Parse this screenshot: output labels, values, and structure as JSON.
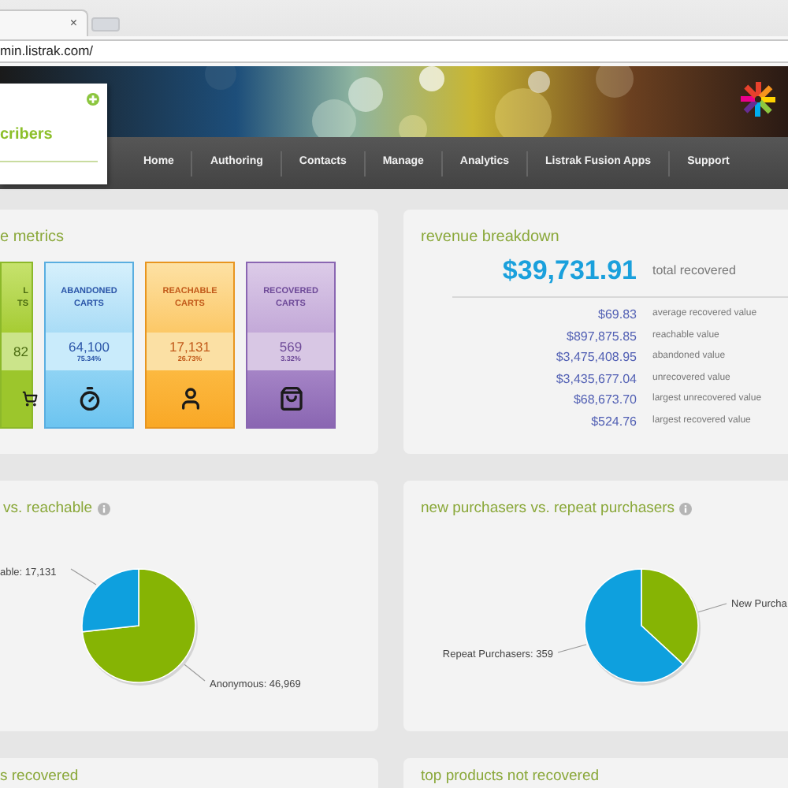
{
  "browser": {
    "tab_close": "×",
    "address": "min.listrak.com/"
  },
  "header": {
    "panel_title": "cribers",
    "nav": [
      {
        "label": "Home"
      },
      {
        "label": "Authoring"
      },
      {
        "label": "Contacts"
      },
      {
        "label": "Manage"
      },
      {
        "label": "Analytics"
      },
      {
        "label": "Listrak Fusion Apps"
      },
      {
        "label": "Support"
      }
    ]
  },
  "cart_metrics": {
    "title": "e metrics",
    "tiles": [
      {
        "kind": "total",
        "title": "L TS",
        "value": "82"
      },
      {
        "kind": "abandoned",
        "title": "ABANDONED CARTS",
        "value": "64,100",
        "percent": "75.34%"
      },
      {
        "kind": "reachable",
        "title": "REACHABLE CARTS",
        "value": "17,131",
        "percent": "26.73%"
      },
      {
        "kind": "recovered",
        "title": "RECOVERED CARTS",
        "value": "569",
        "percent": "3.32%"
      }
    ]
  },
  "revenue_breakdown": {
    "title": "revenue breakdown",
    "total": "$39,731.91",
    "total_label": "total recovered",
    "rows": [
      {
        "value": "$69.83",
        "label": "average recovered value"
      },
      {
        "value": "$897,875.85",
        "label": "reachable value"
      },
      {
        "value": "$3,475,408.95",
        "label": "abandoned value"
      },
      {
        "value": "$3,435,677.04",
        "label": "unrecovered value"
      },
      {
        "value": "$68,673.70",
        "label": "largest unrecovered value"
      },
      {
        "value": "$524.76",
        "label": "largest recovered value"
      }
    ]
  },
  "anonymous_vs_reachable": {
    "title": "vs. reachable",
    "chart_data": {
      "type": "pie",
      "categories": [
        "Anonymous: 46,969",
        "able: 17,131"
      ],
      "values": [
        73.27,
        26.73
      ]
    }
  },
  "new_vs_repeat": {
    "title": "new purchasers vs. repeat purchasers",
    "chart_data": {
      "type": "pie",
      "categories": [
        "New Purcha",
        "Repeat Purchasers: 359"
      ],
      "values": [
        36.9,
        63.1
      ]
    }
  },
  "bottom_panels": [
    {
      "title": "s recovered"
    },
    {
      "title": "top products not recovered"
    }
  ]
}
